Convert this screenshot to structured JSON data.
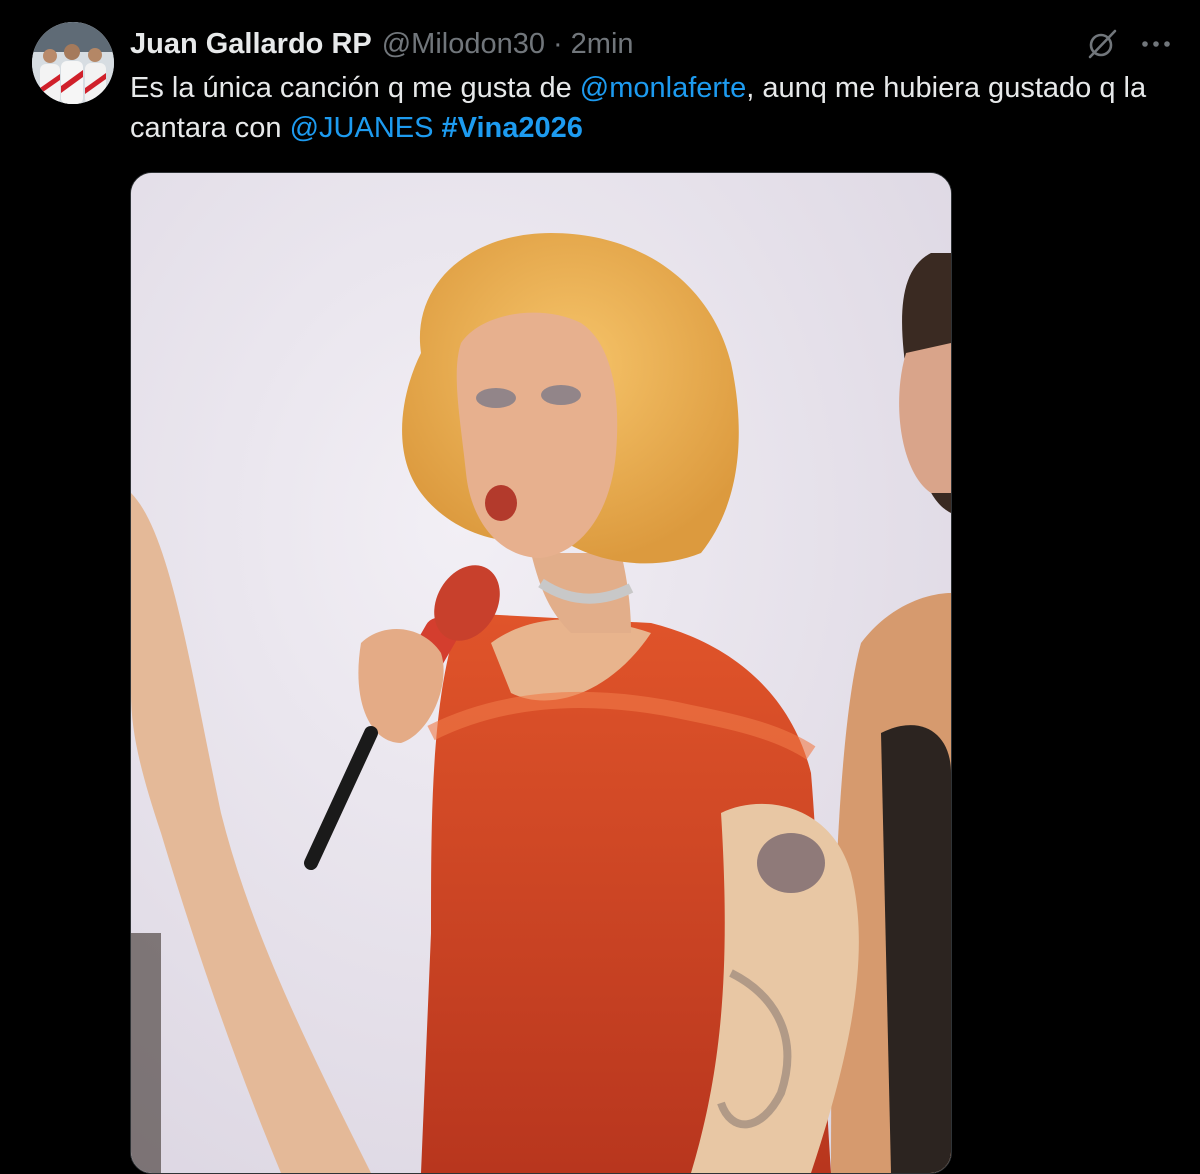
{
  "tweet": {
    "author": {
      "display_name": "Juan Gallardo RP",
      "handle": "@Milodon30",
      "separator": "·",
      "time": "2min",
      "avatar_icon": "user-avatar"
    },
    "text": {
      "part1": "Es la única canción q me gusta de ",
      "mention1": "@monlaferte",
      "part2": ", aunq me hubiera gustado q la cantara con ",
      "mention2": "@JUANES",
      "part3": " ",
      "hashtag": "#Vina2026"
    },
    "actions": {
      "grok_icon": "grok-icon",
      "more_icon": "more-dots-icon"
    },
    "media": {
      "type": "photo"
    }
  },
  "colors": {
    "background": "#000000",
    "text_primary": "#e7e9ea",
    "text_secondary": "#71767b",
    "link": "#1d9bf0",
    "border": "#2f3336"
  }
}
